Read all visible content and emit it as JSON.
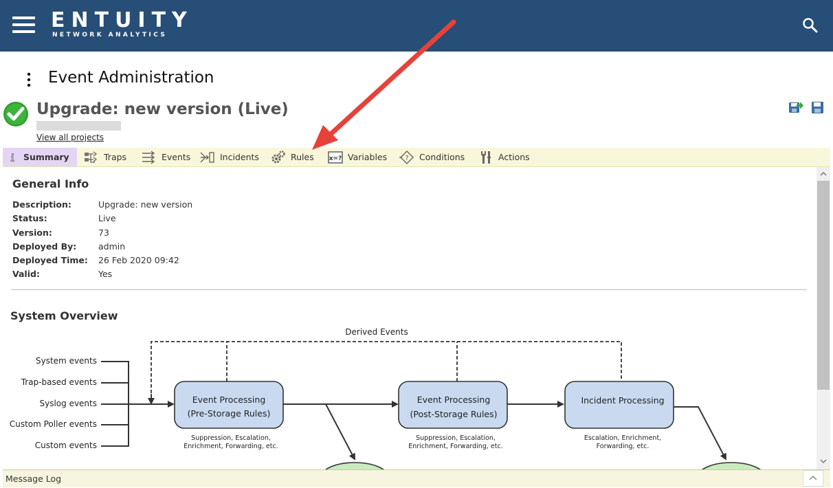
{
  "header": {
    "logo_main": "ENTUITY",
    "logo_sub": "NETWORK ANALYTICS",
    "bg_color": "#274e76"
  },
  "page": {
    "title": "Event Administration"
  },
  "project": {
    "title": "Upgrade: new version (Live)",
    "view_all_link": "View all projects",
    "status_icon": "check-circle-icon"
  },
  "tabs": [
    {
      "label": "Summary",
      "icon": "info-icon",
      "active": true
    },
    {
      "label": "Traps",
      "icon": "traps-icon"
    },
    {
      "label": "Events",
      "icon": "events-icon"
    },
    {
      "label": "Incidents",
      "icon": "incidents-icon"
    },
    {
      "label": "Rules",
      "icon": "gears-icon"
    },
    {
      "label": "Variables",
      "icon": "variables-icon"
    },
    {
      "label": "Conditions",
      "icon": "conditions-icon"
    },
    {
      "label": "Actions",
      "icon": "wrench-icon"
    }
  ],
  "general_info": {
    "title": "General Info",
    "rows": [
      {
        "label": "Description:",
        "value": "Upgrade: new version"
      },
      {
        "label": "Status:",
        "value": "Live"
      },
      {
        "label": "Version:",
        "value": "73"
      },
      {
        "label": "Deployed By:",
        "value": "admin"
      },
      {
        "label": "Deployed Time:",
        "value": "26 Feb 2020 09:42"
      },
      {
        "label": "Valid:",
        "value": "Yes"
      }
    ]
  },
  "system_overview": {
    "title": "System Overview",
    "derived_events": "Derived Events",
    "inputs": [
      "System events",
      "Trap-based events",
      "Syslog events",
      "Custom Poller events",
      "Custom events"
    ],
    "box1": {
      "line1": "Event Processing",
      "line2": "(Pre-Storage Rules)",
      "note1": "Suppression, Escalation,",
      "note2": "Enrichment, Forwarding, etc."
    },
    "box2": {
      "line1": "Event Processing",
      "line2": "(Post-Storage Rules)",
      "note1": "Suppression, Escalation,",
      "note2": "Enrichment, Forwarding, etc."
    },
    "box3": {
      "line1": "Incident Processing",
      "note1": "Escalation, Enrichment,",
      "note2": "Forwarding, etc."
    },
    "box_fill": "#c9daf0",
    "ellipse_fill": "#c8ecc0"
  },
  "message_log": {
    "label": "Message Log"
  },
  "annotation": {
    "arrow_color": "#e8413a"
  }
}
